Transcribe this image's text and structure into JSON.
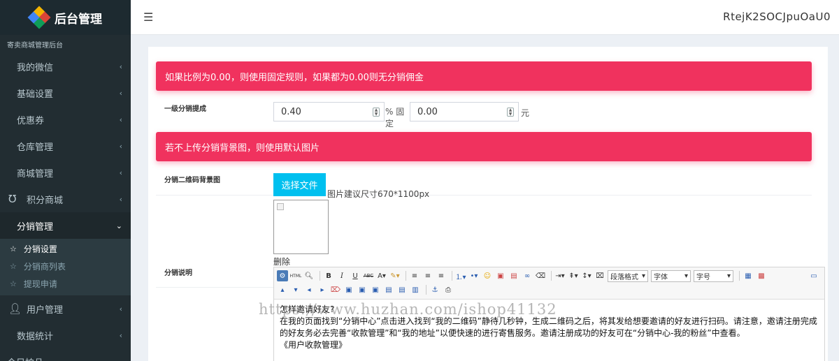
{
  "brand": {
    "title": "后台管理",
    "subtitle": "寄卖商城管理后台"
  },
  "header": {
    "user_code": "RtejK2SOCJpuOaU0"
  },
  "sidebar": {
    "items": [
      {
        "label": "我的微信"
      },
      {
        "label": "基础设置"
      },
      {
        "label": "优惠券"
      },
      {
        "label": "仓库管理"
      },
      {
        "label": "商城管理"
      },
      {
        "label": "积分商城",
        "icon": "magnet-icon"
      },
      {
        "label": "分销管理"
      }
    ],
    "sub_items": [
      {
        "label": "分销设置"
      },
      {
        "label": "分销商列表"
      },
      {
        "label": "提现申请"
      }
    ],
    "items_after": [
      {
        "label": "用户管理",
        "icon": "user-icon"
      },
      {
        "label": "数据统计"
      },
      {
        "label": "今日拍品"
      }
    ]
  },
  "form": {
    "alert1": "如果比例为0.00，则使用固定规则，如果都为0.00则无分销佣金",
    "commission_label": "一级分销提成",
    "percent_value": "0.40",
    "percent_unit": "% 固定",
    "fixed_value": "0.00",
    "fixed_unit": "元",
    "alert2": "若不上传分销背景图，则使用默认图片",
    "qrcode_bg_label": "分销二维码背景图",
    "upload_button": "选择文件",
    "upload_hint": "图片建议尺寸670*1100px",
    "delete_label": "删除",
    "description_label": "分销说明"
  },
  "editor": {
    "paragraph_select": "段落格式",
    "font_select": "字体",
    "size_select": "字号",
    "lines": [
      "怎样邀请好友?",
      "在我的页面找到“分销中心”点击进入找到“我的二维码”静待几秒钟，生成二维码之后，将其发给想要邀请的好友进行扫码。请注意，邀请注册完成的好友务必去完善“收款管理”和“我的地址”以便快速的进行寄售服务。邀请注册成功的好友可在“分销中心-我的粉丝”中查看。",
      "《用户收款管理》"
    ]
  },
  "watermark": "https://www.huzhan.com/ishop41132"
}
